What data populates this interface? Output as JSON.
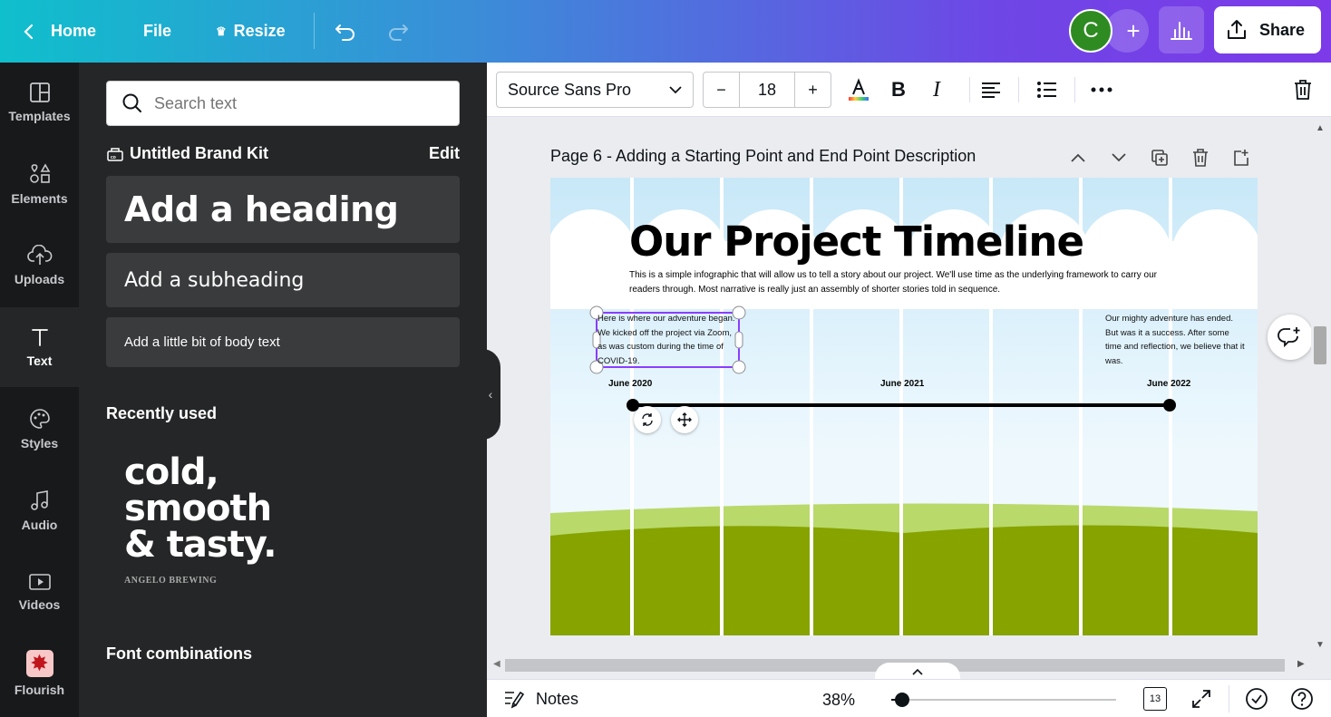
{
  "topbar": {
    "home_label": "Home",
    "file_label": "File",
    "resize_label": "Resize",
    "avatar_initial": "C",
    "share_label": "Share"
  },
  "rail": {
    "items": [
      {
        "label": "Templates",
        "icon": "templates-icon"
      },
      {
        "label": "Elements",
        "icon": "elements-icon"
      },
      {
        "label": "Uploads",
        "icon": "uploads-icon"
      },
      {
        "label": "Text",
        "icon": "text-icon"
      },
      {
        "label": "Styles",
        "icon": "palette-icon"
      },
      {
        "label": "Audio",
        "icon": "music-note-icon"
      },
      {
        "label": "Videos",
        "icon": "video-icon"
      },
      {
        "label": "Flourish",
        "icon": "flourish-icon"
      }
    ],
    "active": "Text"
  },
  "panel": {
    "search_placeholder": "Search text",
    "brand_kit": "Untitled Brand Kit",
    "brand_edit": "Edit",
    "heading": "Add a heading",
    "subheading": "Add a subheading",
    "body": "Add a little bit of body text",
    "recently_used": "Recently used",
    "recent_sample": [
      "cold,",
      "smooth",
      "& tasty."
    ],
    "recent_sample_sub": "ANGELO BREWING",
    "font_combinations": "Font combinations"
  },
  "toolbar": {
    "font_family": "Source Sans Pro",
    "font_size": "18",
    "minus": "−",
    "plus": "+",
    "bold": "B",
    "italic": "I"
  },
  "page": {
    "title": "Page 6 - Adding a Starting Point and End Point Description"
  },
  "slide": {
    "title": "Our Project Timeline",
    "description": "This is a simple infographic that will allow us to tell a story about our project.  We'll use time as the underlying framework to carry our readers through.  Most narrative is really just an assembly of shorter stories told in sequence.",
    "start_text": "Here is  where our adventure began.  We kicked off the project via Zoom, as was custom during the time of COVID-19.",
    "end_text": "Our mighty adventure has ended.  But was it a success.  After some time and reflection, we believe that it was.",
    "dates": [
      "June 2020",
      "June 2021",
      "June 2022"
    ]
  },
  "footer": {
    "notes": "Notes",
    "zoom": "38%",
    "zoom_fraction": 0.05,
    "page_count": "13"
  },
  "colors": {
    "sky": "#c8e8f8",
    "grass_dark": "#86a300",
    "grass_light": "#b7d66a",
    "selection": "#8b3dff",
    "avatar": "#2e8b22"
  }
}
